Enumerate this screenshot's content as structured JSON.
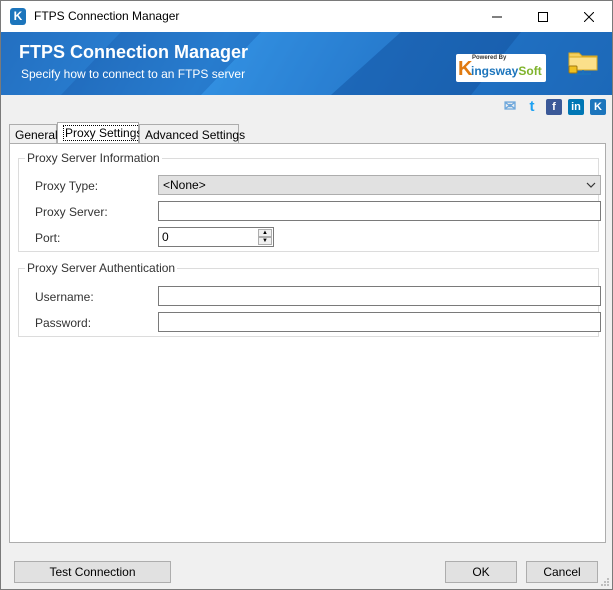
{
  "window": {
    "title": "FTPS Connection Manager",
    "icon_letter": "K",
    "controls": [
      "minimize-icon",
      "maximize-icon",
      "close-icon"
    ]
  },
  "banner": {
    "title": "FTPS Connection Manager",
    "subtitle": "Specify how to connect to an FTPS server",
    "logo": {
      "powered_by": "Powered By",
      "brand_k": "K",
      "brand_ingsway": "ingsway",
      "brand_soft": "Soft"
    }
  },
  "social": [
    {
      "name": "email-icon",
      "glyph": "✉",
      "color": "#6fa8dc"
    },
    {
      "name": "twitter-icon",
      "glyph": "t",
      "color": "#1da1f2"
    },
    {
      "name": "facebook-icon",
      "glyph": "f",
      "color": "#3b5998"
    },
    {
      "name": "linkedin-icon",
      "glyph": "in",
      "color": "#0077b5"
    },
    {
      "name": "kingswaysoft-icon",
      "glyph": "K",
      "color": "#1c75bc"
    }
  ],
  "tabs": [
    {
      "label": "General",
      "active": false
    },
    {
      "label": "Proxy Settings",
      "active": true
    },
    {
      "label": "Advanced Settings",
      "active": false
    }
  ],
  "proxy_info": {
    "group_label": "Proxy Server Information",
    "type_label": "Proxy Type:",
    "type_value": "<None>",
    "server_label": "Proxy Server:",
    "server_value": "",
    "port_label": "Port:",
    "port_value": "0"
  },
  "proxy_auth": {
    "group_label": "Proxy Server Authentication",
    "username_label": "Username:",
    "username_value": "",
    "password_label": "Password:",
    "password_value": ""
  },
  "footer": {
    "test_label": "Test Connection",
    "ok_label": "OK",
    "cancel_label": "Cancel"
  }
}
